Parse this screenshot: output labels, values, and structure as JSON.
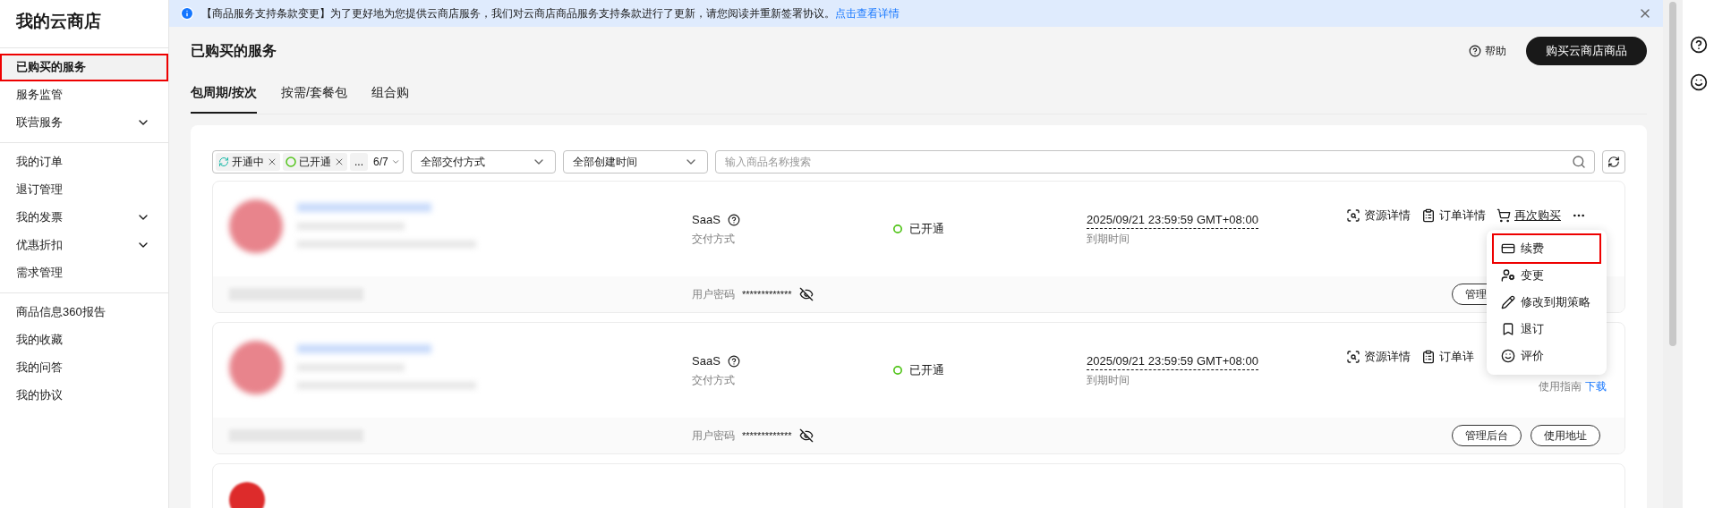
{
  "sidebar": {
    "title": "我的云商店",
    "groups": [
      [
        {
          "label": "已购买的服务",
          "selected": true,
          "highlighted": true
        },
        {
          "label": "服务监管",
          "selected": false,
          "highlighted": false
        },
        {
          "label": "联营服务",
          "selected": false,
          "highlighted": false,
          "expanded": false
        }
      ],
      [
        {
          "label": "我的订单",
          "selected": false,
          "highlighted": false
        },
        {
          "label": "退订管理",
          "selected": false,
          "highlighted": false
        },
        {
          "label": "我的发票",
          "selected": false,
          "highlighted": false,
          "expanded": false
        },
        {
          "label": "优惠折扣",
          "selected": false,
          "highlighted": false,
          "expanded": false
        },
        {
          "label": "需求管理",
          "selected": false,
          "highlighted": false
        }
      ],
      [
        {
          "label": "商品信息360报告",
          "selected": false,
          "highlighted": false
        },
        {
          "label": "我的收藏",
          "selected": false,
          "highlighted": false
        },
        {
          "label": "我的问答",
          "selected": false,
          "highlighted": false
        },
        {
          "label": "我的协议",
          "selected": false,
          "highlighted": false
        }
      ]
    ]
  },
  "banner": {
    "text": "【商品服务支持条款变更】为了更好地为您提供云商店服务，我们对云商店商品服务支持条款进行了更新，请您阅读并重新签署协议。",
    "link": "点击查看详情"
  },
  "page_title": "已购买的服务",
  "help": "帮助",
  "buy_button": "购买云商店商品",
  "tabs": [
    {
      "label": "包周期/按次",
      "selected": true
    },
    {
      "label": "按需/套餐包",
      "selected": false
    },
    {
      "label": "组合购",
      "selected": false
    }
  ],
  "filters": {
    "status_tags": [
      {
        "label": "开通中",
        "kind": "syncing"
      },
      {
        "label": "已开通",
        "kind": "active"
      }
    ],
    "more": "...",
    "count": "6/7",
    "delivery_select": "全部交付方式",
    "time_select": "全部创建时间",
    "search": {
      "placeholder": "输入商品名称搜索"
    }
  },
  "services": [
    {
      "delivery": "SaaS",
      "delivery_label": "交付方式",
      "status": "已开通",
      "expiry": "2025/09/21 23:59:59 GMT+08:00",
      "expiry_label": "到期时间",
      "actions": [
        {
          "label": "资源详情",
          "kind": "resource"
        },
        {
          "label": "订单详情",
          "kind": "order"
        },
        {
          "label": "再次购买",
          "kind": "rebuy"
        }
      ],
      "password_label": "用户密码",
      "password": "*************",
      "buttons": [
        "管理"
      ]
    },
    {
      "delivery": "SaaS",
      "delivery_label": "交付方式",
      "status": "已开通",
      "expiry": "2025/09/21 23:59:59 GMT+08:00",
      "expiry_label": "到期时间",
      "actions": [
        {
          "label": "资源详情",
          "kind": "resource"
        },
        {
          "label": "订单详",
          "kind": "order"
        }
      ],
      "guide": "使用指南",
      "guide_link": "下载",
      "password_label": "用户密码",
      "password": "*************",
      "buttons": [
        "管理后台",
        "使用地址"
      ]
    }
  ],
  "menu": [
    {
      "label": "续费",
      "kind": "renew",
      "highlighted": true
    },
    {
      "label": "变更",
      "kind": "change",
      "highlighted": false
    },
    {
      "label": "修改到期策略",
      "kind": "policy",
      "highlighted": false
    },
    {
      "label": "退订",
      "kind": "unsubscribe",
      "highlighted": false
    },
    {
      "label": "评价",
      "kind": "rate",
      "highlighted": false
    }
  ]
}
